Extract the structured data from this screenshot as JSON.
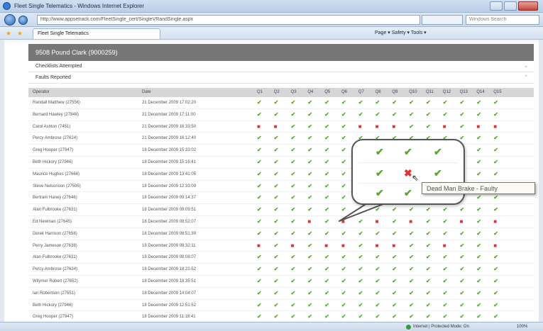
{
  "window": {
    "title": "Fleet Single Telematics - Windows Internet Explorer"
  },
  "address": {
    "url": "http://www.appsetrack.com/FleetSingle_cert/SingleVRandSingle.aspx",
    "search_placeholder": "Windows Search"
  },
  "tab": {
    "label": "Fleet Single Telematics"
  },
  "commands": {
    "text": "Page ▾  Safety ▾  Tools ▾"
  },
  "driver_header": "9508 Pound Clark (9000259)",
  "sections": [
    {
      "label": "Checklists Attempted"
    },
    {
      "label": "Faults Reported"
    }
  ],
  "columns": {
    "operator": "Operator",
    "date": "Date",
    "questions": [
      "Q1",
      "Q2",
      "Q3",
      "Q4",
      "Q5",
      "Q6",
      "Q7",
      "Q8",
      "Q9",
      "Q10",
      "Q11",
      "Q12",
      "Q13",
      "Q14",
      "Q15"
    ]
  },
  "rows": [
    {
      "operator": "Randall Matthew (27556)",
      "date": "21 December 2009 17:02:20",
      "marks": "ooooooooooooooo"
    },
    {
      "operator": "Bernard Hawley (27848)",
      "date": "21 December 2009 17:11:00",
      "marks": "ooooooooooooooo"
    },
    {
      "operator": "Carol Ashton (7451)",
      "date": "21 December 2009 16:33:50",
      "marks": "xxooooxxxooxoxx"
    },
    {
      "operator": "Percy Ambrose (27624)",
      "date": "21 December 2009 16:12:40",
      "marks": "ooooooooooooooo"
    },
    {
      "operator": "Greg Hooper (27947)",
      "date": "18 December 2009 15:33:02",
      "marks": "ooooooooooooooo"
    },
    {
      "operator": "Beth Hickory (27946)",
      "date": "18 December 2009 15:16:41",
      "marks": "ooooooooooooooo"
    },
    {
      "operator": "Maurice Hughes (27666)",
      "date": "18 December 2009 13:41:05",
      "marks": "ooooooooooooooo"
    },
    {
      "operator": "Steve Nelsonson (27595)",
      "date": "18 December 2009 12:33:09",
      "marks": "ooooooooooooooo"
    },
    {
      "operator": "Bertram Haney (27646)",
      "date": "18 December 2009 09:14:37",
      "marks": "ooooooooooooooo"
    },
    {
      "operator": "Alan Fulbrooke (27631)",
      "date": "18 December 2009 09:09:51",
      "marks": "ooooooooooooooo"
    },
    {
      "operator": "Ed Newman (27645)",
      "date": "18 December 2009 08:52:07",
      "marks": "oooxoxoxoxooxox"
    },
    {
      "operator": "Derek Harrison (27658)",
      "date": "18 December 2009 08:51:39",
      "marks": "ooooooooooooooo"
    },
    {
      "operator": "Perry Jameson (27638)",
      "date": "18 December 2009 08:32:11",
      "marks": "xoxoxxoxxooxoox"
    },
    {
      "operator": "Alan Fulbrooke (27631)",
      "date": "18 December 2009 08:08:07",
      "marks": "ooooooooooooooo"
    },
    {
      "operator": "Percy Ambrose (27624)",
      "date": "18 December 2009 18:22:52",
      "marks": "ooooooooooooooo"
    },
    {
      "operator": "Wilymer Robert (27652)",
      "date": "18 December 2009 18:35:51",
      "marks": "ooooooooooooooo"
    },
    {
      "operator": "Ian Robertson (27551)",
      "date": "18 December 2009 14:04:07",
      "marks": "ooooooooooooooo"
    },
    {
      "operator": "Beth Hickory (27946)",
      "date": "18 December 2009 12:51:52",
      "marks": "ooooooooooooooo"
    },
    {
      "operator": "Greg Hooper (27947)",
      "date": "18 December 2009 11:18:41",
      "marks": "ooooooooooooooo"
    }
  ],
  "callout": {
    "tooltip": "Dead Man Brake - Faulty"
  },
  "status": {
    "zone": "Internet | Protected Mode: On",
    "zoom": "100%"
  },
  "colors": {
    "ok": "#5aa72a",
    "fault": "#e03030",
    "header": "#777777"
  }
}
